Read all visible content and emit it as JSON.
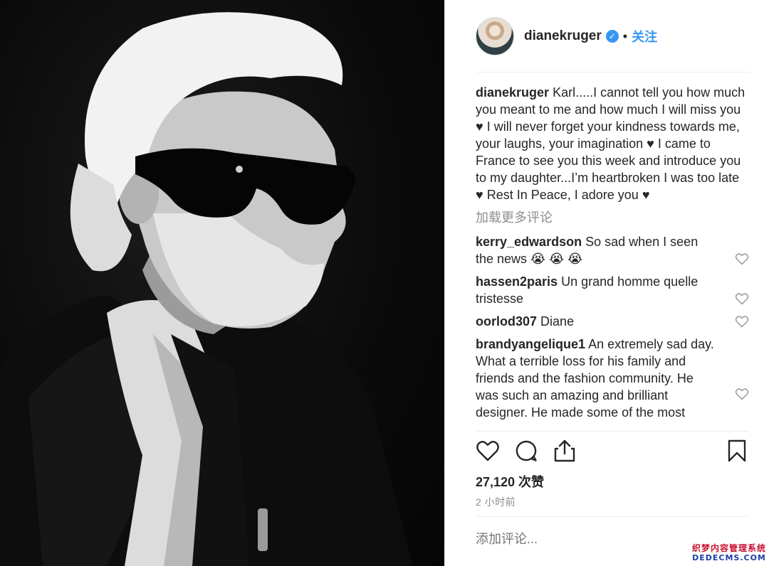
{
  "post": {
    "username": "dianekruger",
    "verified_icon": "verified-badge-icon",
    "dot": "•",
    "follow_label": "关注",
    "caption": {
      "username": "dianekruger",
      "text": "Karl.....I cannot tell you how much you meant to me and how much I will miss you ♥ I will never forget your kindness towards me, your laughs, your imagination ♥ I came to France to see you this week and introduce you to my daughter...I’m heartbroken I was too late ♥ Rest In Peace, I adore you ♥"
    },
    "load_more_label": "加载更多评论",
    "comments": [
      {
        "username": "kerry_edwardson",
        "text": "So sad when I seen the news 😭 😭 😭"
      },
      {
        "username": "hassen2paris",
        "text": "Un grand homme quelle tristesse"
      },
      {
        "username": "oorlod307",
        "text": "Diane"
      },
      {
        "username": "brandyangelique1",
        "text": "An extremely sad day. What a terrible loss for his family and friends and the fashion community. He was such an amazing and brilliant designer. He made some of the most"
      }
    ],
    "likes_label": "27,120 次赞",
    "time_label": "2 小时前",
    "add_comment_placeholder": "添加评论..."
  },
  "icons": {
    "like": "heart-outline-icon",
    "comment": "speech-bubble-icon",
    "share": "share-upload-icon",
    "save": "bookmark-icon",
    "comment_like": "small-heart-icon"
  },
  "watermark": {
    "line1": "织梦内容管理系统",
    "line2": "DEDECMS.COM"
  },
  "colors": {
    "link_blue": "#3897f0",
    "text": "#262626",
    "muted": "#8e8e8e",
    "divider": "#efefef"
  }
}
